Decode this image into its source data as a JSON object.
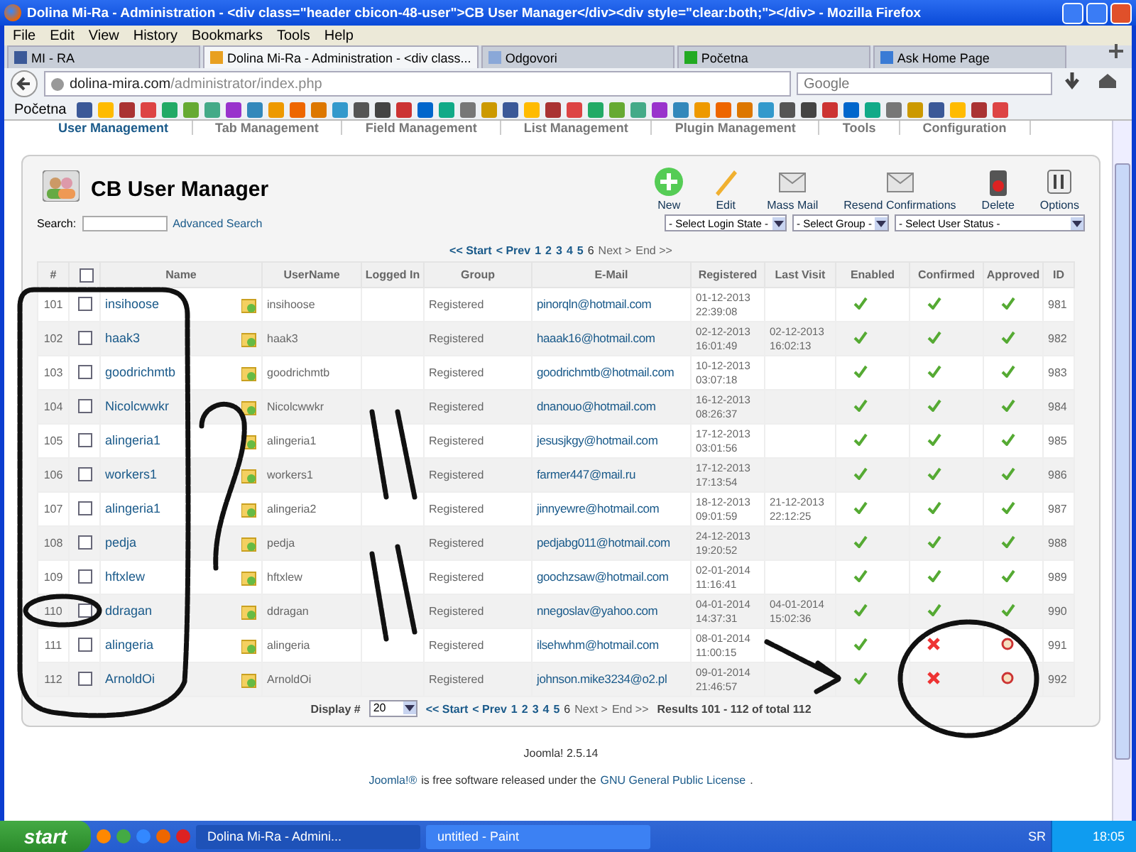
{
  "window": {
    "title": "Dolina Mi-Ra - Administration - <div class=\"header cbicon-48-user\">CB User Manager</div><div style=\"clear:both;\"></div> - Mozilla Firefox"
  },
  "menu": [
    "File",
    "Edit",
    "View",
    "History",
    "Bookmarks",
    "Tools",
    "Help"
  ],
  "tabs": [
    {
      "label": "MI - RA",
      "selected": false
    },
    {
      "label": "Dolina Mi-Ra - Administration - <div class...",
      "selected": true
    },
    {
      "label": "Odgovori",
      "selected": false
    },
    {
      "label": "Početna",
      "selected": false
    },
    {
      "label": "Ask Home Page",
      "selected": false
    }
  ],
  "address": {
    "host": "dolina-mira.com",
    "path": "/administrator/index.php"
  },
  "search": {
    "placeholder": "Google"
  },
  "bookmarks": {
    "label": "Početna"
  },
  "cb_tabs": [
    {
      "label": "User Management",
      "selected": true
    },
    {
      "label": "Tab Management",
      "selected": false
    },
    {
      "label": "Field Management",
      "selected": false
    },
    {
      "label": "List Management",
      "selected": false
    },
    {
      "label": "Plugin Management",
      "selected": false
    },
    {
      "label": "Tools",
      "selected": false
    },
    {
      "label": "Configuration",
      "selected": false
    }
  ],
  "header": {
    "title": "CB User Manager"
  },
  "toolbar": [
    {
      "label": "New",
      "kind": "new"
    },
    {
      "label": "Edit",
      "kind": "edit"
    },
    {
      "label": "Mass Mail",
      "kind": "mail"
    },
    {
      "label": "Resend Confirmations",
      "kind": "mail"
    },
    {
      "label": "Delete",
      "kind": "delete"
    },
    {
      "label": "Options",
      "kind": "options"
    }
  ],
  "filter_bar": {
    "search_label": "Search:",
    "advanced": "Advanced Search",
    "selects": [
      "- Select Login State -",
      "- Select Group -",
      "- Select User Status -"
    ]
  },
  "pagination": {
    "links": [
      {
        "label": "<< Start",
        "disabled": false
      },
      {
        "label": "< Prev",
        "disabled": false
      }
    ],
    "pages": [
      {
        "label": "1",
        "selected": false
      },
      {
        "label": "2",
        "selected": false
      },
      {
        "label": "3",
        "selected": false
      },
      {
        "label": "4",
        "selected": false
      },
      {
        "label": "5",
        "selected": false
      },
      {
        "label": "6",
        "selected": true
      }
    ],
    "after": [
      {
        "label": "Next >",
        "disabled": true
      },
      {
        "label": "End >>",
        "disabled": true
      }
    ]
  },
  "pagination_bottom": {
    "links": [
      {
        "label": "<< Start",
        "disabled": false
      },
      {
        "label": "< Prev",
        "disabled": false
      }
    ],
    "pages": [
      {
        "label": "1",
        "selected": false
      },
      {
        "label": "2",
        "selected": false
      },
      {
        "label": "3",
        "selected": false
      },
      {
        "label": "4",
        "selected": false
      },
      {
        "label": "5",
        "selected": false
      },
      {
        "label": "6",
        "selected": true
      }
    ],
    "after": [
      {
        "label": "Next >",
        "disabled": true
      },
      {
        "label": "End >>",
        "disabled": true
      }
    ]
  },
  "select_all_checked": false,
  "columns": [
    "#",
    "Name",
    "UserName",
    "Logged In",
    "Group",
    "E-Mail",
    "Registered",
    "Last Visit",
    "Enabled",
    "Confirmed",
    "Approved",
    "ID"
  ],
  "rows": [
    {
      "num": "101",
      "checked": false,
      "name": "insihoose",
      "username": "insihoose",
      "group": "Registered",
      "email": "pinorqln@hotmail.com",
      "registered": "01-12-2013 22:39:08",
      "last_visit": "",
      "enabled": true,
      "confirmed": true,
      "approved": true,
      "id": "981"
    },
    {
      "num": "102",
      "checked": false,
      "name": "haak3",
      "username": "haak3",
      "group": "Registered",
      "email": "haaak16@hotmail.com",
      "registered": "02-12-2013 16:01:49",
      "last_visit": "02-12-2013 16:02:13",
      "enabled": true,
      "confirmed": true,
      "approved": true,
      "id": "982"
    },
    {
      "num": "103",
      "checked": false,
      "name": "goodrichmtb",
      "username": "goodrichmtb",
      "group": "Registered",
      "email": "goodrichmtb@hotmail.com",
      "registered": "10-12-2013 03:07:18",
      "last_visit": "",
      "enabled": true,
      "confirmed": true,
      "approved": true,
      "id": "983"
    },
    {
      "num": "104",
      "checked": false,
      "name": "Nicolcwwkr",
      "username": "Nicolcwwkr",
      "group": "Registered",
      "email": "dnanouo@hotmail.com",
      "registered": "16-12-2013 08:26:37",
      "last_visit": "",
      "enabled": true,
      "confirmed": true,
      "approved": true,
      "id": "984"
    },
    {
      "num": "105",
      "checked": false,
      "name": "alingeria1",
      "username": "alingeria1",
      "group": "Registered",
      "email": "jesusjkgy@hotmail.com",
      "registered": "17-12-2013 03:01:56",
      "last_visit": "",
      "enabled": true,
      "confirmed": true,
      "approved": true,
      "id": "985"
    },
    {
      "num": "106",
      "checked": false,
      "name": "workers1",
      "username": "workers1",
      "group": "Registered",
      "email": "farmer447@mail.ru",
      "registered": "17-12-2013 17:13:54",
      "last_visit": "",
      "enabled": true,
      "confirmed": true,
      "approved": true,
      "id": "986"
    },
    {
      "num": "107",
      "checked": false,
      "name": "alingeria1",
      "username": "alingeria2",
      "group": "Registered",
      "email": "jinnyewre@hotmail.com",
      "registered": "18-12-2013 09:01:59",
      "last_visit": "21-12-2013 22:12:25",
      "enabled": true,
      "confirmed": true,
      "approved": true,
      "id": "987"
    },
    {
      "num": "108",
      "checked": false,
      "name": "pedja",
      "username": "pedja",
      "group": "Registered",
      "email": "pedjabg011@hotmail.com",
      "registered": "24-12-2013 19:20:52",
      "last_visit": "",
      "enabled": true,
      "confirmed": true,
      "approved": true,
      "id": "988"
    },
    {
      "num": "109",
      "checked": false,
      "name": "hftxlew",
      "username": "hftxlew",
      "group": "Registered",
      "email": "goochzsaw@hotmail.com",
      "registered": "02-01-2014 11:16:41",
      "last_visit": "",
      "enabled": true,
      "confirmed": true,
      "approved": true,
      "id": "989"
    },
    {
      "num": "110",
      "checked": false,
      "name": "ddragan",
      "username": "ddragan",
      "group": "Registered",
      "email": "nnegoslav@yahoo.com",
      "registered": "04-01-2014 14:37:31",
      "last_visit": "04-01-2014 15:02:36",
      "enabled": true,
      "confirmed": true,
      "approved": true,
      "id": "990"
    },
    {
      "num": "111",
      "checked": false,
      "name": "alingeria",
      "username": "alingeria",
      "group": "Registered",
      "email": "ilsehwhm@hotmail.com",
      "registered": "08-01-2014 11:00:15",
      "last_visit": "",
      "enabled": true,
      "confirmed": false,
      "approved": false,
      "id": "991"
    },
    {
      "num": "112",
      "checked": false,
      "name": "ArnoldOi",
      "username": "ArnoldOi",
      "group": "Registered",
      "email": "johnson.mike3234@o2.pl",
      "registered": "09-01-2014 21:46:57",
      "last_visit": "",
      "enabled": true,
      "confirmed": false,
      "approved": false,
      "id": "992"
    }
  ],
  "footer": {
    "display_label": "Display #",
    "display_value": "20",
    "results": "Results 101 - 112 of total 112"
  },
  "version": "Joomla! 2.5.14",
  "license": {
    "brand": "Joomla!®",
    "text": "is free software released under the",
    "link": "GNU General Public License",
    "end": "."
  },
  "taskbar": {
    "start": "start",
    "tasks": [
      {
        "label": "Dolina Mi-Ra - Admini...",
        "selected": true
      },
      {
        "label": "untitled - Paint",
        "selected": false
      }
    ],
    "lang": "SR",
    "clock": "18:05"
  }
}
